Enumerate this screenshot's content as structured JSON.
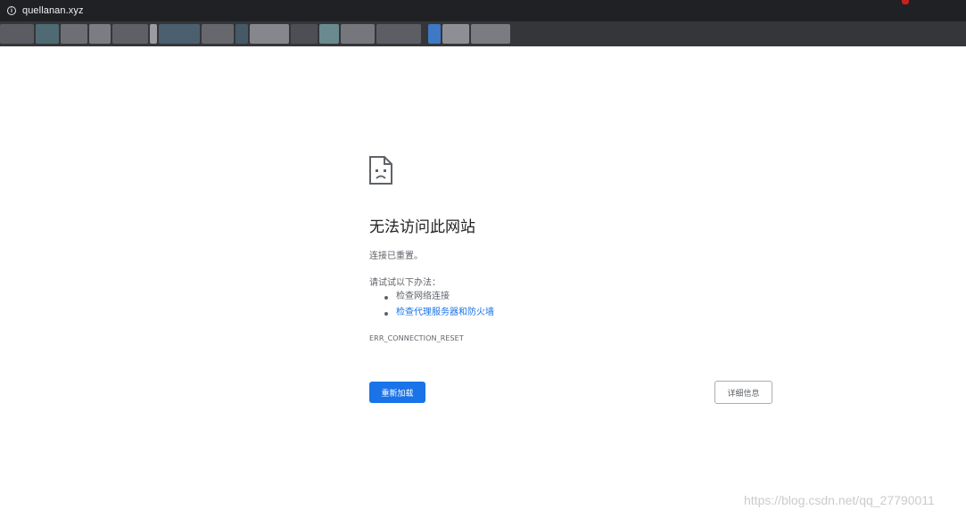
{
  "address_bar": {
    "url": "quellanan.xyz",
    "info_icon": "info-icon"
  },
  "error_page": {
    "icon": "sad-page-icon",
    "heading": "无法访问此网站",
    "message": "连接已重置。",
    "try_label": "请试试以下办法：",
    "suggestions": [
      {
        "label": "检查网络连接",
        "is_link": false
      },
      {
        "label": "检查代理服务器和防火墙",
        "is_link": true
      }
    ],
    "error_code": "ERR_CONNECTION_RESET",
    "reload_label": "重新加载",
    "details_label": "详细信息"
  },
  "watermark": "https://blog.csdn.net/qq_27790011",
  "colors": {
    "primary_blue": "#1a73e8",
    "toolbar_dark": "#202124",
    "bookmarks_bar": "#35363a",
    "text_gray": "#5f6368"
  }
}
